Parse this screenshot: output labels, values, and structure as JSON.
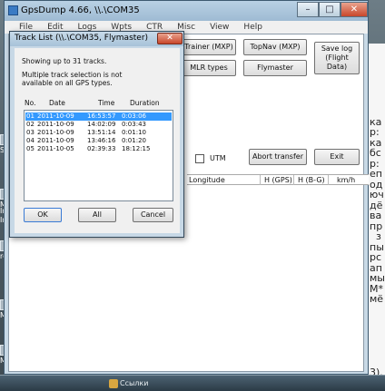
{
  "desktop": {
    "icons": [
      "Sk",
      "Mi",
      "Inte",
      "Inte",
      "rec Pic",
      "MC Pic",
      "Mc Fin"
    ],
    "right_doc_lines": [
      "",
      "",
      "",
      "",
      "",
      "",
      "",
      "ка",
      "р:",
      "ка",
      "бс",
      "р:",
      "еп",
      "од",
      "юч",
      "дё",
      "ва",
      "пр",
      "  з",
      "пы",
      "рс",
      "ап",
      "мы",
      "М*",
      "мё",
      "",
      "",
      "",
      "",
      "",
      "",
      "3)."
    ],
    "taskbar": {
      "items": [
        "Ссылки"
      ]
    }
  },
  "main_window": {
    "title": "GpsDump 4.66, \\\\.\\COM35",
    "title_buttons": {
      "minimize": "–",
      "maximize": "□",
      "close": "✕"
    },
    "menu": [
      "File",
      "Edit",
      "Logs",
      "Wpts",
      "CTR",
      "Misc",
      "View",
      "Help"
    ],
    "buttons": {
      "trainer": "Trainer (MXP)",
      "topnav": "TopNav (MXP)",
      "save_log": "Save log\n(Flight Data)",
      "mlr": "MLR types",
      "flymaster": "Flymaster",
      "abort": "Abort transfer",
      "exit": "Exit"
    },
    "utm_label": "UTM",
    "columns": [
      "Longitude",
      "H (GPS)",
      "H (B-G)",
      "km/h"
    ]
  },
  "dialog": {
    "title": "Track List (\\\\.\\COM35, Flymaster)",
    "close": "✕",
    "info1": "Showing up to 31 tracks.",
    "info2": "Multiple track selection is not",
    "info3": "available on all GPS types.",
    "headers": {
      "no": "No.",
      "date": "Date",
      "time": "Time",
      "duration": "Duration"
    },
    "tracks": [
      {
        "no": "01",
        "date": "2011-10-09",
        "time": "16:53:57",
        "duration": "0:03:06",
        "selected": true
      },
      {
        "no": "02",
        "date": "2011-10-09",
        "time": "14:02:09",
        "duration": "0:03:43",
        "selected": false
      },
      {
        "no": "03",
        "date": "2011-10-09",
        "time": "13:51:14",
        "duration": "0:01:10",
        "selected": false
      },
      {
        "no": "04",
        "date": "2011-10-09",
        "time": "13:46:16",
        "duration": "0:01:20",
        "selected": false
      },
      {
        "no": "05",
        "date": "2011-10-05",
        "time": "02:39:33",
        "duration": "18:12:15",
        "selected": false
      }
    ],
    "buttons": {
      "ok": "OK",
      "all": "All",
      "cancel": "Cancel"
    }
  }
}
